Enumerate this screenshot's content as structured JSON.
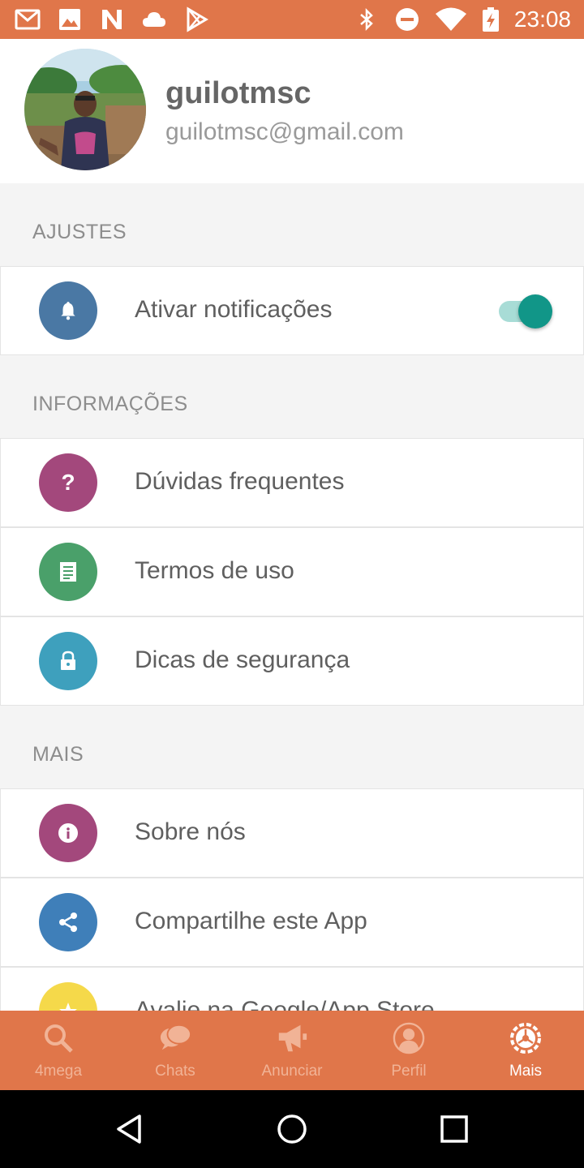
{
  "status_bar": {
    "time": "23:08",
    "left_icons": [
      "gmail-icon",
      "gallery-icon",
      "n-app-icon",
      "cloud-icon",
      "play-store-icon"
    ],
    "right_icons": [
      "bluetooth-icon",
      "do-not-disturb-icon",
      "wifi-icon",
      "battery-charging-icon"
    ],
    "color": "#e0764a"
  },
  "profile": {
    "username": "guilotmsc",
    "email": "guilotmsc@gmail.com"
  },
  "sections": {
    "ajustes": {
      "label": "AJUSTES",
      "items": [
        {
          "label": "Ativar notificações",
          "icon": "bell-icon",
          "color": "#4a78a4",
          "toggle_on": true
        }
      ]
    },
    "informacoes": {
      "label": "INFORMAÇÕES",
      "items": [
        {
          "label": "Dúvidas frequentes",
          "icon": "question-icon",
          "color": "#a3487c"
        },
        {
          "label": "Termos de uso",
          "icon": "document-icon",
          "color": "#4aa06a"
        },
        {
          "label": "Dicas de segurança",
          "icon": "lock-icon",
          "color": "#3ea0bd"
        }
      ]
    },
    "mais": {
      "label": "MAIS",
      "items": [
        {
          "label": "Sobre nós",
          "icon": "info-icon",
          "color": "#a3487c"
        },
        {
          "label": "Compartilhe este App",
          "icon": "share-icon",
          "color": "#3f7fb9"
        },
        {
          "label": "Avalie na Google/App Store",
          "icon": "star-icon",
          "color": "#f5d94a"
        }
      ]
    }
  },
  "bottom_nav": {
    "items": [
      {
        "label": "4mega",
        "icon": "search-icon"
      },
      {
        "label": "Chats",
        "icon": "chat-bubbles-icon"
      },
      {
        "label": "Anunciar",
        "icon": "megaphone-icon"
      },
      {
        "label": "Perfil",
        "icon": "person-icon"
      },
      {
        "label": "Mais",
        "icon": "settings-icon",
        "active": true
      }
    ]
  },
  "android_nav": {
    "buttons": [
      "back-icon",
      "home-icon",
      "recents-icon"
    ]
  }
}
